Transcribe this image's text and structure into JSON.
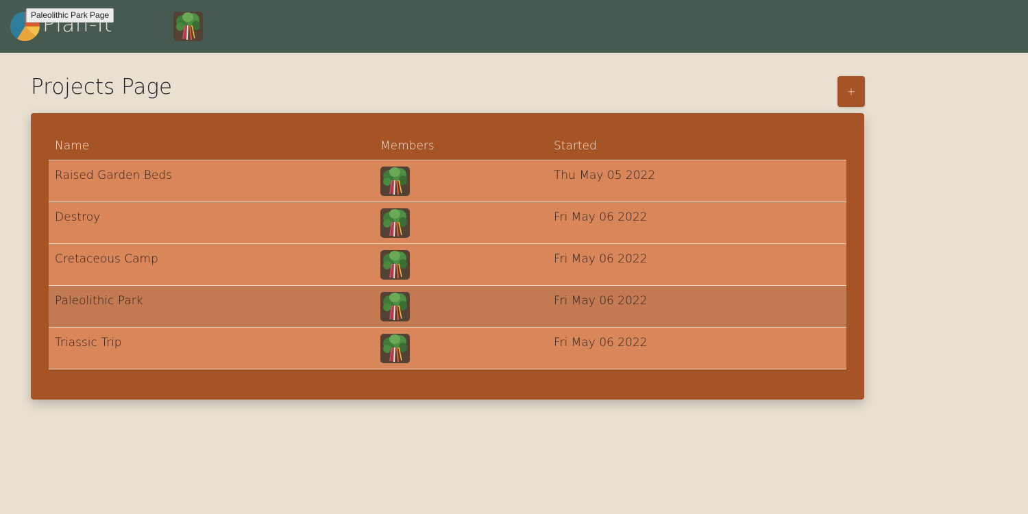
{
  "header": {
    "brand": "Plan-It",
    "tooltip": "Paleolithic Park Page",
    "logo_icon": "pie-chart-logo-icon",
    "user_avatar_icon": "chard-avatar-icon"
  },
  "main": {
    "title": "Projects Page",
    "add_label": "+",
    "table": {
      "columns": [
        "Name",
        "Members",
        "Started"
      ],
      "rows": [
        {
          "name": "Raised Garden Beds",
          "member_avatar": "chard-avatar-icon",
          "started": "Thu May 05 2022"
        },
        {
          "name": "Destroy",
          "member_avatar": "chard-avatar-icon",
          "started": "Fri May 06 2022"
        },
        {
          "name": "Cretaceous Camp",
          "member_avatar": "chard-avatar-icon",
          "started": "Fri May 06 2022"
        },
        {
          "name": "Paleolithic Park",
          "member_avatar": "chard-avatar-icon",
          "started": "Fri May 06 2022"
        },
        {
          "name": "Triassic Trip",
          "member_avatar": "chard-avatar-icon",
          "started": "Fri May 06 2022"
        }
      ]
    }
  },
  "colors": {
    "topbar": "#465a52",
    "background": "#e9e0d2",
    "card": "#a65325",
    "row": "#d8865a",
    "row_hover": "#c37a53"
  }
}
